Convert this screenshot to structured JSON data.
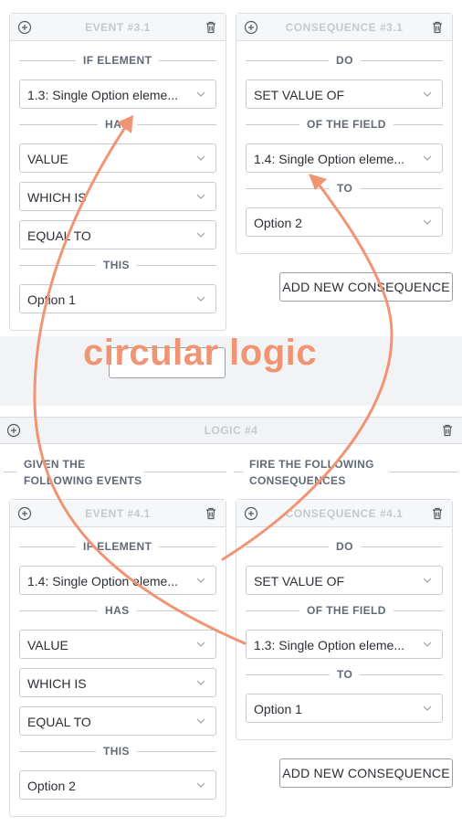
{
  "logic3": {
    "event": {
      "title": "EVENT  #3.1",
      "if_element_label": "IF ELEMENT",
      "element_value": "1.3: Single Option eleme...",
      "has_label": "HAS",
      "has_value": "VALUE",
      "which_is_value": "WHICH IS",
      "equal_to_value": "EQUAL TO",
      "this_label": "THIS",
      "this_value": "Option 1"
    },
    "consequence": {
      "title": "CONSEQUENCE  #3.1",
      "do_label": "DO",
      "do_value": "SET VALUE OF",
      "of_field_label": "OF THE FIELD",
      "field_value": "1.4: Single Option eleme...",
      "to_label": "TO",
      "to_value": "Option 2"
    },
    "add_consequence_label": "ADD NEW CONSEQUENCE"
  },
  "annotation": {
    "text": "circular logic",
    "color": "#f19473"
  },
  "logic4": {
    "title": "LOGIC  #4",
    "given_label_1": "GIVEN THE",
    "given_label_2": "FOLLOWING EVENTS",
    "fire_label_1": "FIRE THE FOLLOWING",
    "fire_label_2": "CONSEQUENCES",
    "event": {
      "title": "EVENT  #4.1",
      "if_element_label": "IF ELEMENT",
      "element_value": "1.4: Single Option eleme...",
      "has_label": "HAS",
      "has_value": "VALUE",
      "which_is_value": "WHICH IS",
      "equal_to_value": "EQUAL TO",
      "this_label": "THIS",
      "this_value": "Option 2"
    },
    "consequence": {
      "title": "CONSEQUENCE  #4.1",
      "do_label": "DO",
      "do_value": "SET VALUE OF",
      "of_field_label": "OF THE FIELD",
      "field_value": "1.3: Single Option eleme...",
      "to_label": "TO",
      "to_value": "Option 1"
    },
    "add_consequence_label": "ADD NEW CONSEQUENCE"
  },
  "icons": {
    "add": "plus-circle-icon",
    "delete": "trash-icon",
    "dropdown": "chevron-down-icon"
  },
  "colors": {
    "arrow": "#f19473",
    "border": "#d9dde2",
    "muted_title": "#c5c9ce"
  }
}
